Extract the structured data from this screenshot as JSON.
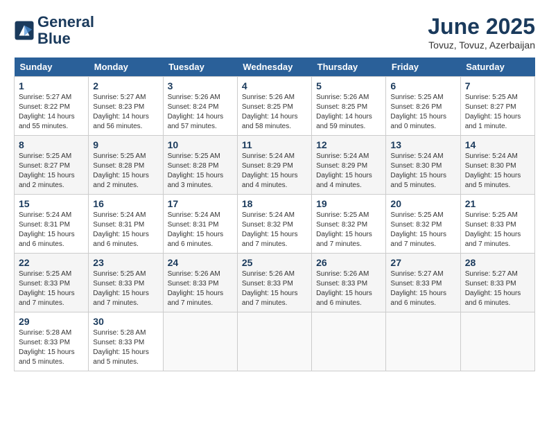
{
  "header": {
    "logo_line1": "General",
    "logo_line2": "Blue",
    "month_title": "June 2025",
    "location": "Tovuz, Tovuz, Azerbaijan"
  },
  "weekdays": [
    "Sunday",
    "Monday",
    "Tuesday",
    "Wednesday",
    "Thursday",
    "Friday",
    "Saturday"
  ],
  "weeks": [
    [
      {
        "day": "1",
        "info": "Sunrise: 5:27 AM\nSunset: 8:22 PM\nDaylight: 14 hours\nand 55 minutes."
      },
      {
        "day": "2",
        "info": "Sunrise: 5:27 AM\nSunset: 8:23 PM\nDaylight: 14 hours\nand 56 minutes."
      },
      {
        "day": "3",
        "info": "Sunrise: 5:26 AM\nSunset: 8:24 PM\nDaylight: 14 hours\nand 57 minutes."
      },
      {
        "day": "4",
        "info": "Sunrise: 5:26 AM\nSunset: 8:25 PM\nDaylight: 14 hours\nand 58 minutes."
      },
      {
        "day": "5",
        "info": "Sunrise: 5:26 AM\nSunset: 8:25 PM\nDaylight: 14 hours\nand 59 minutes."
      },
      {
        "day": "6",
        "info": "Sunrise: 5:25 AM\nSunset: 8:26 PM\nDaylight: 15 hours\nand 0 minutes."
      },
      {
        "day": "7",
        "info": "Sunrise: 5:25 AM\nSunset: 8:27 PM\nDaylight: 15 hours\nand 1 minute."
      }
    ],
    [
      {
        "day": "8",
        "info": "Sunrise: 5:25 AM\nSunset: 8:27 PM\nDaylight: 15 hours\nand 2 minutes."
      },
      {
        "day": "9",
        "info": "Sunrise: 5:25 AM\nSunset: 8:28 PM\nDaylight: 15 hours\nand 2 minutes."
      },
      {
        "day": "10",
        "info": "Sunrise: 5:25 AM\nSunset: 8:28 PM\nDaylight: 15 hours\nand 3 minutes."
      },
      {
        "day": "11",
        "info": "Sunrise: 5:24 AM\nSunset: 8:29 PM\nDaylight: 15 hours\nand 4 minutes."
      },
      {
        "day": "12",
        "info": "Sunrise: 5:24 AM\nSunset: 8:29 PM\nDaylight: 15 hours\nand 4 minutes."
      },
      {
        "day": "13",
        "info": "Sunrise: 5:24 AM\nSunset: 8:30 PM\nDaylight: 15 hours\nand 5 minutes."
      },
      {
        "day": "14",
        "info": "Sunrise: 5:24 AM\nSunset: 8:30 PM\nDaylight: 15 hours\nand 5 minutes."
      }
    ],
    [
      {
        "day": "15",
        "info": "Sunrise: 5:24 AM\nSunset: 8:31 PM\nDaylight: 15 hours\nand 6 minutes."
      },
      {
        "day": "16",
        "info": "Sunrise: 5:24 AM\nSunset: 8:31 PM\nDaylight: 15 hours\nand 6 minutes."
      },
      {
        "day": "17",
        "info": "Sunrise: 5:24 AM\nSunset: 8:31 PM\nDaylight: 15 hours\nand 6 minutes."
      },
      {
        "day": "18",
        "info": "Sunrise: 5:24 AM\nSunset: 8:32 PM\nDaylight: 15 hours\nand 7 minutes."
      },
      {
        "day": "19",
        "info": "Sunrise: 5:25 AM\nSunset: 8:32 PM\nDaylight: 15 hours\nand 7 minutes."
      },
      {
        "day": "20",
        "info": "Sunrise: 5:25 AM\nSunset: 8:32 PM\nDaylight: 15 hours\nand 7 minutes."
      },
      {
        "day": "21",
        "info": "Sunrise: 5:25 AM\nSunset: 8:33 PM\nDaylight: 15 hours\nand 7 minutes."
      }
    ],
    [
      {
        "day": "22",
        "info": "Sunrise: 5:25 AM\nSunset: 8:33 PM\nDaylight: 15 hours\nand 7 minutes."
      },
      {
        "day": "23",
        "info": "Sunrise: 5:25 AM\nSunset: 8:33 PM\nDaylight: 15 hours\nand 7 minutes."
      },
      {
        "day": "24",
        "info": "Sunrise: 5:26 AM\nSunset: 8:33 PM\nDaylight: 15 hours\nand 7 minutes."
      },
      {
        "day": "25",
        "info": "Sunrise: 5:26 AM\nSunset: 8:33 PM\nDaylight: 15 hours\nand 7 minutes."
      },
      {
        "day": "26",
        "info": "Sunrise: 5:26 AM\nSunset: 8:33 PM\nDaylight: 15 hours\nand 6 minutes."
      },
      {
        "day": "27",
        "info": "Sunrise: 5:27 AM\nSunset: 8:33 PM\nDaylight: 15 hours\nand 6 minutes."
      },
      {
        "day": "28",
        "info": "Sunrise: 5:27 AM\nSunset: 8:33 PM\nDaylight: 15 hours\nand 6 minutes."
      }
    ],
    [
      {
        "day": "29",
        "info": "Sunrise: 5:28 AM\nSunset: 8:33 PM\nDaylight: 15 hours\nand 5 minutes."
      },
      {
        "day": "30",
        "info": "Sunrise: 5:28 AM\nSunset: 8:33 PM\nDaylight: 15 hours\nand 5 minutes."
      },
      {
        "day": "",
        "info": ""
      },
      {
        "day": "",
        "info": ""
      },
      {
        "day": "",
        "info": ""
      },
      {
        "day": "",
        "info": ""
      },
      {
        "day": "",
        "info": ""
      }
    ]
  ]
}
